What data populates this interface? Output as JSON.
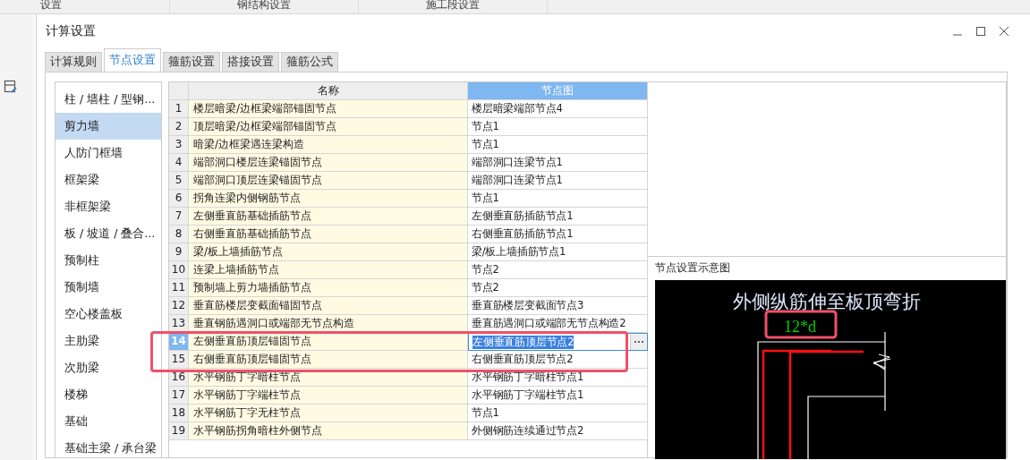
{
  "background_header": {
    "columns": [
      "设置",
      "钢结构设置",
      "施工段设置"
    ]
  },
  "window": {
    "title": "计算设置"
  },
  "tabs": [
    {
      "label": "计算规则",
      "selected": false
    },
    {
      "label": "节点设置",
      "selected": true
    },
    {
      "label": "箍筋设置",
      "selected": false
    },
    {
      "label": "搭接设置",
      "selected": false
    },
    {
      "label": "箍筋公式",
      "selected": false
    }
  ],
  "categories": [
    {
      "label": "柱 / 墙柱 / 型钢...",
      "selected": false
    },
    {
      "label": "剪力墙",
      "selected": true
    },
    {
      "label": "人防门框墙",
      "selected": false
    },
    {
      "label": "框架梁",
      "selected": false
    },
    {
      "label": "非框架梁",
      "selected": false
    },
    {
      "label": "板 / 坡道 / 叠合...",
      "selected": false
    },
    {
      "label": "预制柱",
      "selected": false
    },
    {
      "label": "预制墙",
      "selected": false
    },
    {
      "label": "空心楼盖板",
      "selected": false
    },
    {
      "label": "主肋梁",
      "selected": false
    },
    {
      "label": "次肋梁",
      "selected": false
    },
    {
      "label": "楼梯",
      "selected": false
    },
    {
      "label": "基础",
      "selected": false
    },
    {
      "label": "基础主梁 / 承台梁",
      "selected": false
    }
  ],
  "table": {
    "columns": [
      {
        "label": "名称",
        "selected": false
      },
      {
        "label": "节点图",
        "selected": true
      }
    ],
    "rows": [
      {
        "number": "1",
        "name": "楼层暗梁/边框梁端部锚固节点",
        "node": "楼层暗梁端部节点4",
        "selected": false,
        "highlighted": false
      },
      {
        "number": "2",
        "name": "顶层暗梁/边框梁端部锚固节点",
        "node": "节点1",
        "selected": false,
        "highlighted": false
      },
      {
        "number": "3",
        "name": "暗梁/边框梁遇连梁构造",
        "node": "节点1",
        "selected": false,
        "highlighted": false
      },
      {
        "number": "4",
        "name": "端部洞口楼层连梁锚固节点",
        "node": "端部洞口连梁节点1",
        "selected": false,
        "highlighted": false
      },
      {
        "number": "5",
        "name": "端部洞口顶层连梁锚固节点",
        "node": "端部洞口连梁节点1",
        "selected": false,
        "highlighted": false
      },
      {
        "number": "6",
        "name": "拐角连梁内侧钢筋节点",
        "node": "节点1",
        "selected": false,
        "highlighted": false
      },
      {
        "number": "7",
        "name": "左侧垂直筋基础插筋节点",
        "node": "左侧垂直筋插筋节点1",
        "selected": false,
        "highlighted": false
      },
      {
        "number": "8",
        "name": "右侧垂直筋基础插筋节点",
        "node": "右侧垂直筋插筋节点1",
        "selected": false,
        "highlighted": false
      },
      {
        "number": "9",
        "name": "梁/板上墙插筋节点",
        "node": "梁/板上墙插筋节点1",
        "selected": false,
        "highlighted": false
      },
      {
        "number": "10",
        "name": "连梁上墙插筋节点",
        "node": "节点2",
        "selected": false,
        "highlighted": false
      },
      {
        "number": "11",
        "name": "预制墙上剪力墙插筋节点",
        "node": "节点2",
        "selected": false,
        "highlighted": false
      },
      {
        "number": "12",
        "name": "垂直筋楼层变截面锚固节点",
        "node": "垂直筋楼层变截面节点3",
        "selected": false,
        "highlighted": false
      },
      {
        "number": "13",
        "name": "垂直钢筋遇洞口或端部无节点构造",
        "node": "垂直筋遇洞口或端部无节点构造2",
        "selected": false,
        "highlighted": false
      },
      {
        "number": "14",
        "name": "左侧垂直筋顶层锚固节点",
        "node": "左侧垂直筋顶层节点2",
        "selected": true,
        "highlighted": true
      },
      {
        "number": "15",
        "name": "右侧垂直筋顶层锚固节点",
        "node": "右侧垂直筋顶层节点2",
        "selected": false,
        "highlighted": true
      },
      {
        "number": "16",
        "name": "水平钢筋丁字暗柱节点",
        "node": "水平钢筋丁字暗柱节点1",
        "selected": false,
        "highlighted": false
      },
      {
        "number": "17",
        "name": "水平钢筋丁字端柱节点",
        "node": "水平钢筋丁字端柱节点1",
        "selected": false,
        "highlighted": false
      },
      {
        "number": "18",
        "name": "水平钢筋丁字无柱节点",
        "node": "节点1",
        "selected": false,
        "highlighted": false
      },
      {
        "number": "19",
        "name": "水平钢筋拐角暗柱外侧节点",
        "node": "外侧钢筋连续通过节点2",
        "selected": false,
        "highlighted": false
      }
    ]
  },
  "preview": {
    "label": "节点设置示意图",
    "caption": "外侧纵筋伸至板顶弯折",
    "dimension": "12*d",
    "dimension_highlighted": true
  }
}
